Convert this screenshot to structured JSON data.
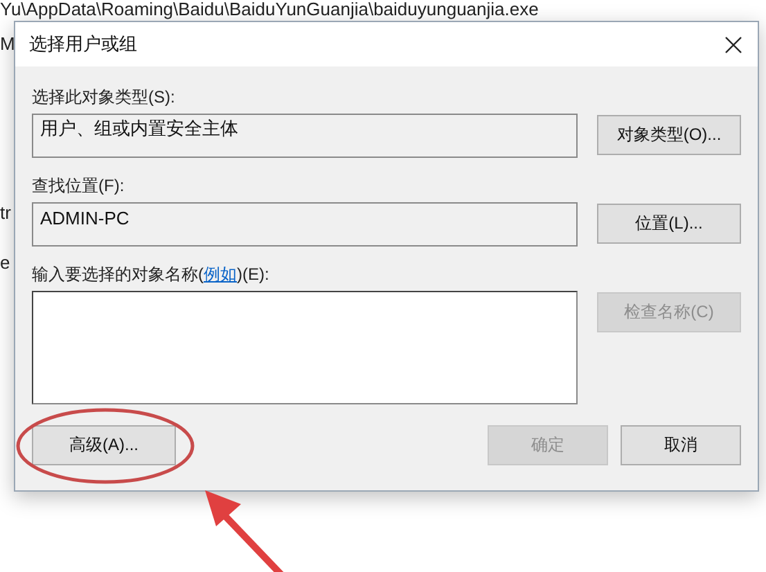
{
  "background_window": {
    "path": "Yu\\AppData\\Roaming\\Baidu\\BaiduYunGuanjia\\baiduyunguanjia.exe",
    "fragments": [
      "M",
      "tr",
      "e"
    ]
  },
  "dialog": {
    "title": "选择用户或组",
    "object_type": {
      "label": "选择此对象类型(S):",
      "value": "用户、组或内置安全主体",
      "button": {
        "label": "对象类型(O)...",
        "disabled": false
      }
    },
    "location": {
      "label": "查找位置(F):",
      "value": "ADMIN-PC",
      "button": {
        "label": "位置(L)...",
        "disabled": false
      }
    },
    "names": {
      "label_before": "输入要选择的对象名称(",
      "link": "例如",
      "label_after": ")(E):",
      "button": {
        "label": "检查名称(C)",
        "disabled": true
      }
    },
    "footer_buttons": [
      {
        "label": "高级(A)...",
        "disabled": false,
        "highlighted": true
      },
      {
        "label": "确定",
        "disabled": true,
        "highlighted": false
      },
      {
        "label": "取消",
        "disabled": false,
        "highlighted": false
      }
    ]
  }
}
